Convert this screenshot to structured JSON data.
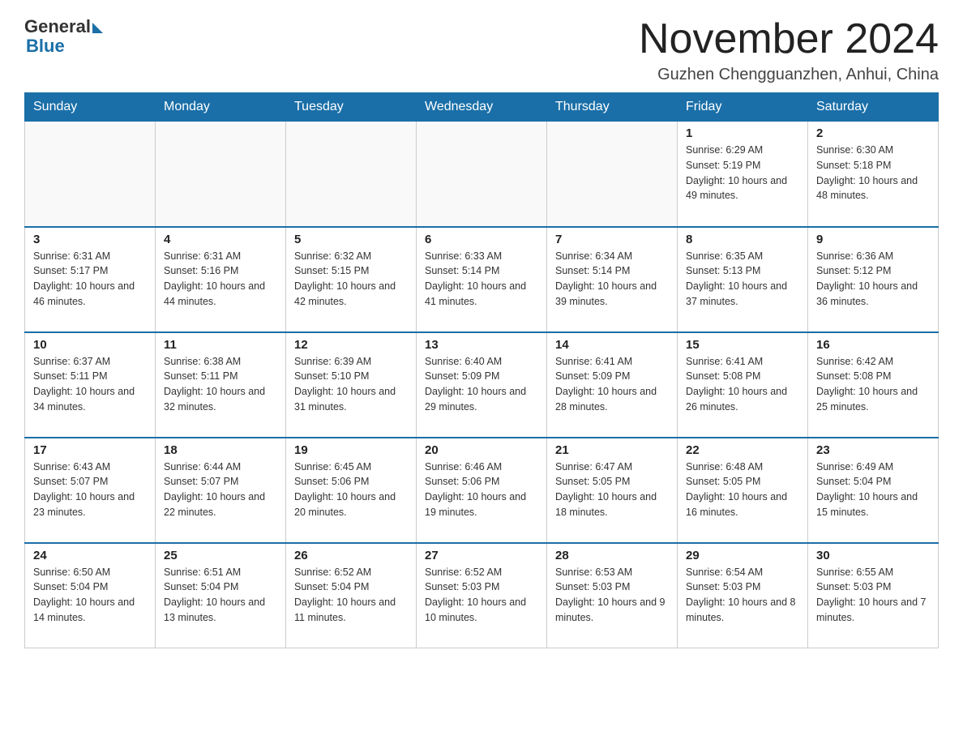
{
  "header": {
    "logo_general": "General",
    "logo_blue": "Blue",
    "month_title": "November 2024",
    "location": "Guzhen Chengguanzhen, Anhui, China"
  },
  "weekdays": [
    "Sunday",
    "Monday",
    "Tuesday",
    "Wednesday",
    "Thursday",
    "Friday",
    "Saturday"
  ],
  "weeks": [
    [
      {
        "day": "",
        "sunrise": "",
        "sunset": "",
        "daylight": ""
      },
      {
        "day": "",
        "sunrise": "",
        "sunset": "",
        "daylight": ""
      },
      {
        "day": "",
        "sunrise": "",
        "sunset": "",
        "daylight": ""
      },
      {
        "day": "",
        "sunrise": "",
        "sunset": "",
        "daylight": ""
      },
      {
        "day": "",
        "sunrise": "",
        "sunset": "",
        "daylight": ""
      },
      {
        "day": "1",
        "sunrise": "Sunrise: 6:29 AM",
        "sunset": "Sunset: 5:19 PM",
        "daylight": "Daylight: 10 hours and 49 minutes."
      },
      {
        "day": "2",
        "sunrise": "Sunrise: 6:30 AM",
        "sunset": "Sunset: 5:18 PM",
        "daylight": "Daylight: 10 hours and 48 minutes."
      }
    ],
    [
      {
        "day": "3",
        "sunrise": "Sunrise: 6:31 AM",
        "sunset": "Sunset: 5:17 PM",
        "daylight": "Daylight: 10 hours and 46 minutes."
      },
      {
        "day": "4",
        "sunrise": "Sunrise: 6:31 AM",
        "sunset": "Sunset: 5:16 PM",
        "daylight": "Daylight: 10 hours and 44 minutes."
      },
      {
        "day": "5",
        "sunrise": "Sunrise: 6:32 AM",
        "sunset": "Sunset: 5:15 PM",
        "daylight": "Daylight: 10 hours and 42 minutes."
      },
      {
        "day": "6",
        "sunrise": "Sunrise: 6:33 AM",
        "sunset": "Sunset: 5:14 PM",
        "daylight": "Daylight: 10 hours and 41 minutes."
      },
      {
        "day": "7",
        "sunrise": "Sunrise: 6:34 AM",
        "sunset": "Sunset: 5:14 PM",
        "daylight": "Daylight: 10 hours and 39 minutes."
      },
      {
        "day": "8",
        "sunrise": "Sunrise: 6:35 AM",
        "sunset": "Sunset: 5:13 PM",
        "daylight": "Daylight: 10 hours and 37 minutes."
      },
      {
        "day": "9",
        "sunrise": "Sunrise: 6:36 AM",
        "sunset": "Sunset: 5:12 PM",
        "daylight": "Daylight: 10 hours and 36 minutes."
      }
    ],
    [
      {
        "day": "10",
        "sunrise": "Sunrise: 6:37 AM",
        "sunset": "Sunset: 5:11 PM",
        "daylight": "Daylight: 10 hours and 34 minutes."
      },
      {
        "day": "11",
        "sunrise": "Sunrise: 6:38 AM",
        "sunset": "Sunset: 5:11 PM",
        "daylight": "Daylight: 10 hours and 32 minutes."
      },
      {
        "day": "12",
        "sunrise": "Sunrise: 6:39 AM",
        "sunset": "Sunset: 5:10 PM",
        "daylight": "Daylight: 10 hours and 31 minutes."
      },
      {
        "day": "13",
        "sunrise": "Sunrise: 6:40 AM",
        "sunset": "Sunset: 5:09 PM",
        "daylight": "Daylight: 10 hours and 29 minutes."
      },
      {
        "day": "14",
        "sunrise": "Sunrise: 6:41 AM",
        "sunset": "Sunset: 5:09 PM",
        "daylight": "Daylight: 10 hours and 28 minutes."
      },
      {
        "day": "15",
        "sunrise": "Sunrise: 6:41 AM",
        "sunset": "Sunset: 5:08 PM",
        "daylight": "Daylight: 10 hours and 26 minutes."
      },
      {
        "day": "16",
        "sunrise": "Sunrise: 6:42 AM",
        "sunset": "Sunset: 5:08 PM",
        "daylight": "Daylight: 10 hours and 25 minutes."
      }
    ],
    [
      {
        "day": "17",
        "sunrise": "Sunrise: 6:43 AM",
        "sunset": "Sunset: 5:07 PM",
        "daylight": "Daylight: 10 hours and 23 minutes."
      },
      {
        "day": "18",
        "sunrise": "Sunrise: 6:44 AM",
        "sunset": "Sunset: 5:07 PM",
        "daylight": "Daylight: 10 hours and 22 minutes."
      },
      {
        "day": "19",
        "sunrise": "Sunrise: 6:45 AM",
        "sunset": "Sunset: 5:06 PM",
        "daylight": "Daylight: 10 hours and 20 minutes."
      },
      {
        "day": "20",
        "sunrise": "Sunrise: 6:46 AM",
        "sunset": "Sunset: 5:06 PM",
        "daylight": "Daylight: 10 hours and 19 minutes."
      },
      {
        "day": "21",
        "sunrise": "Sunrise: 6:47 AM",
        "sunset": "Sunset: 5:05 PM",
        "daylight": "Daylight: 10 hours and 18 minutes."
      },
      {
        "day": "22",
        "sunrise": "Sunrise: 6:48 AM",
        "sunset": "Sunset: 5:05 PM",
        "daylight": "Daylight: 10 hours and 16 minutes."
      },
      {
        "day": "23",
        "sunrise": "Sunrise: 6:49 AM",
        "sunset": "Sunset: 5:04 PM",
        "daylight": "Daylight: 10 hours and 15 minutes."
      }
    ],
    [
      {
        "day": "24",
        "sunrise": "Sunrise: 6:50 AM",
        "sunset": "Sunset: 5:04 PM",
        "daylight": "Daylight: 10 hours and 14 minutes."
      },
      {
        "day": "25",
        "sunrise": "Sunrise: 6:51 AM",
        "sunset": "Sunset: 5:04 PM",
        "daylight": "Daylight: 10 hours and 13 minutes."
      },
      {
        "day": "26",
        "sunrise": "Sunrise: 6:52 AM",
        "sunset": "Sunset: 5:04 PM",
        "daylight": "Daylight: 10 hours and 11 minutes."
      },
      {
        "day": "27",
        "sunrise": "Sunrise: 6:52 AM",
        "sunset": "Sunset: 5:03 PM",
        "daylight": "Daylight: 10 hours and 10 minutes."
      },
      {
        "day": "28",
        "sunrise": "Sunrise: 6:53 AM",
        "sunset": "Sunset: 5:03 PM",
        "daylight": "Daylight: 10 hours and 9 minutes."
      },
      {
        "day": "29",
        "sunrise": "Sunrise: 6:54 AM",
        "sunset": "Sunset: 5:03 PM",
        "daylight": "Daylight: 10 hours and 8 minutes."
      },
      {
        "day": "30",
        "sunrise": "Sunrise: 6:55 AM",
        "sunset": "Sunset: 5:03 PM",
        "daylight": "Daylight: 10 hours and 7 minutes."
      }
    ]
  ]
}
